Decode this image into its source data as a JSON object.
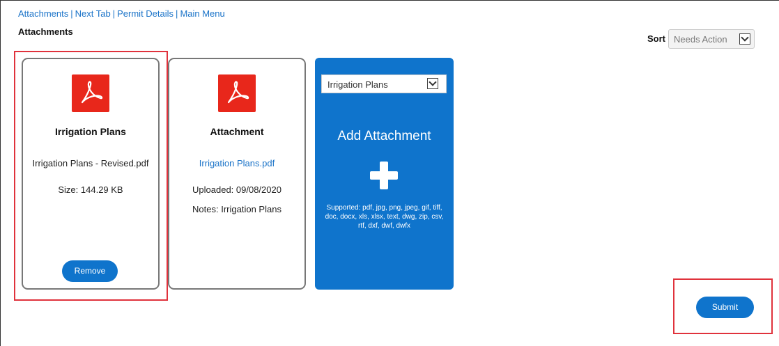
{
  "nav": {
    "links": [
      "Attachments",
      "Next Tab",
      "Permit Details",
      "Main Menu"
    ],
    "separator": "|"
  },
  "page_title": "Attachments",
  "sort": {
    "label": "Sort",
    "value": "Needs Action"
  },
  "cards": [
    {
      "icon": "pdf-icon",
      "title": "Irrigation Plans",
      "filename": "Irrigation Plans - Revised.pdf",
      "size": "Size: 144.29 KB",
      "button": "Remove"
    },
    {
      "icon": "pdf-icon",
      "title": "Attachment",
      "filename": "Irrigation Plans.pdf",
      "uploaded": "Uploaded: 09/08/2020",
      "notes": "Notes: Irrigation Plans"
    }
  ],
  "add_attachment": {
    "type_value": "Irrigation Plans",
    "title": "Add Attachment",
    "icon": "plus-icon",
    "supported": "Supported: pdf, jpg, png, jpeg, gif, tiff, doc, docx, xls, xlsx, text, dwg, zip, csv, rtf, dxf, dwf, dwfx"
  },
  "submit_label": "Submit",
  "colors": {
    "accent": "#0f74cc",
    "link": "#1a73c8",
    "pdf_red": "#e8271b",
    "highlight": "#e0323c"
  }
}
